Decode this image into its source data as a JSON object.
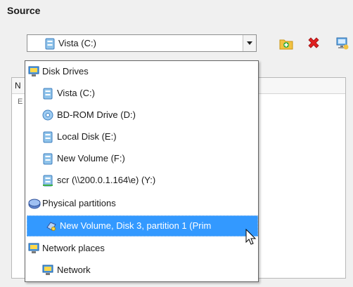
{
  "section_title": "Source",
  "source_combo": {
    "selected": "Vista (C:)",
    "selected_icon": "drive-icon"
  },
  "toolbar": [
    {
      "name": "add-folder-icon",
      "color": "#e8b52a"
    },
    {
      "name": "delete-icon",
      "color": "#e02020"
    },
    {
      "name": "network-add-icon",
      "color": "#3a7bd5"
    }
  ],
  "background_panel": {
    "column_header": "N",
    "row_label": "E"
  },
  "dropdown": {
    "items": [
      {
        "label": "Disk Drives",
        "icon": "monitor-icon",
        "level": "category"
      },
      {
        "label": "Vista (C:)",
        "icon": "drive-icon",
        "level": "sub"
      },
      {
        "label": "BD-ROM Drive (D:)",
        "icon": "disc-icon",
        "level": "sub"
      },
      {
        "label": "Local Disk (E:)",
        "icon": "drive-icon",
        "level": "sub"
      },
      {
        "label": "New Volume (F:)",
        "icon": "drive-icon",
        "level": "sub"
      },
      {
        "label": "scr (\\\\200.0.1.164\\e) (Y:)",
        "icon": "network-drive-icon",
        "level": "sub"
      },
      {
        "label": "Physical partitions",
        "icon": "partitions-icon",
        "level": "category"
      },
      {
        "label": "New Volume, Disk 3, partition 1 (Prim",
        "icon": "partition-icon",
        "level": "sub",
        "selected": true
      },
      {
        "label": "Network places",
        "icon": "monitor-icon",
        "level": "category"
      },
      {
        "label": "Network",
        "icon": "monitor-icon",
        "level": "sub"
      }
    ],
    "selection_color": "#3399ff"
  }
}
